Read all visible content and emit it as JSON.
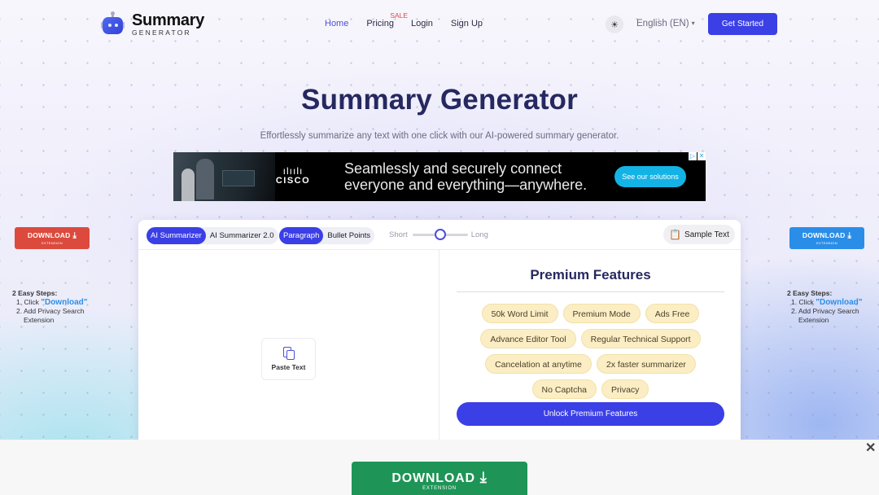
{
  "header": {
    "logo_title": "Summary",
    "logo_subtitle": "GENERATOR",
    "nav": [
      {
        "label": "Home",
        "active": true
      },
      {
        "label": "Pricing",
        "badge": "SALE"
      },
      {
        "label": "Login"
      },
      {
        "label": "Sign Up"
      }
    ],
    "theme_icon": "☀",
    "language": "English (EN)",
    "language_caret": "▾",
    "get_started": "Get Started"
  },
  "hero": {
    "title": "Summary Generator",
    "subtitle": "Effortlessly summarize any text with one click with our AI-powered summary generator."
  },
  "ad_banner": {
    "brand": "CISCO",
    "brand_bars": "ılıılı",
    "line1": "Seamlessly and securely connect",
    "line2": "everyone and everything—anywhere.",
    "cta": "See our solutions",
    "adchoices_icon": "▷",
    "close_icon": "✕"
  },
  "side_ads": {
    "download_label": "DOWNLOAD",
    "download_sub": "EXTENSION",
    "download_icon": "⤓",
    "steps_heading": "2 Easy Steps:",
    "step1_prefix": "1. Click ",
    "step1_link": "\"Download\"",
    "step2_line1": "2. Add Privacy Search",
    "step2_line2": "Extension",
    "left_color": "#db4a3d",
    "right_color": "#2a8ee8"
  },
  "tool": {
    "mode_options": [
      "AI Summarizer",
      "AI Summarizer 2.0"
    ],
    "mode_selected": "AI Summarizer",
    "format_options": [
      "Paragraph",
      "Bullet Points"
    ],
    "format_selected": "Paragraph",
    "length_min_label": "Short",
    "length_max_label": "Long",
    "length_value": 0.5,
    "sample_text": "Sample Text",
    "paste_text": "Paste Text"
  },
  "premium": {
    "title": "Premium Features",
    "features": [
      "50k Word Limit",
      "Premium Mode",
      "Ads Free",
      "Advance Editor Tool",
      "Regular Technical Support",
      "Cancelation at anytime",
      "2x faster summarizer",
      "No Captcha",
      "Privacy"
    ],
    "unlock_button": "Unlock Premium Features"
  },
  "bottom_bar": {
    "download_label": "DOWNLOAD",
    "download_sub": "EXTENSION",
    "close_icon": "✕"
  },
  "colors": {
    "accent": "#3b3fe6",
    "heading": "#262860",
    "chip_bg": "#fbeec4",
    "download_green": "#1e9556"
  }
}
